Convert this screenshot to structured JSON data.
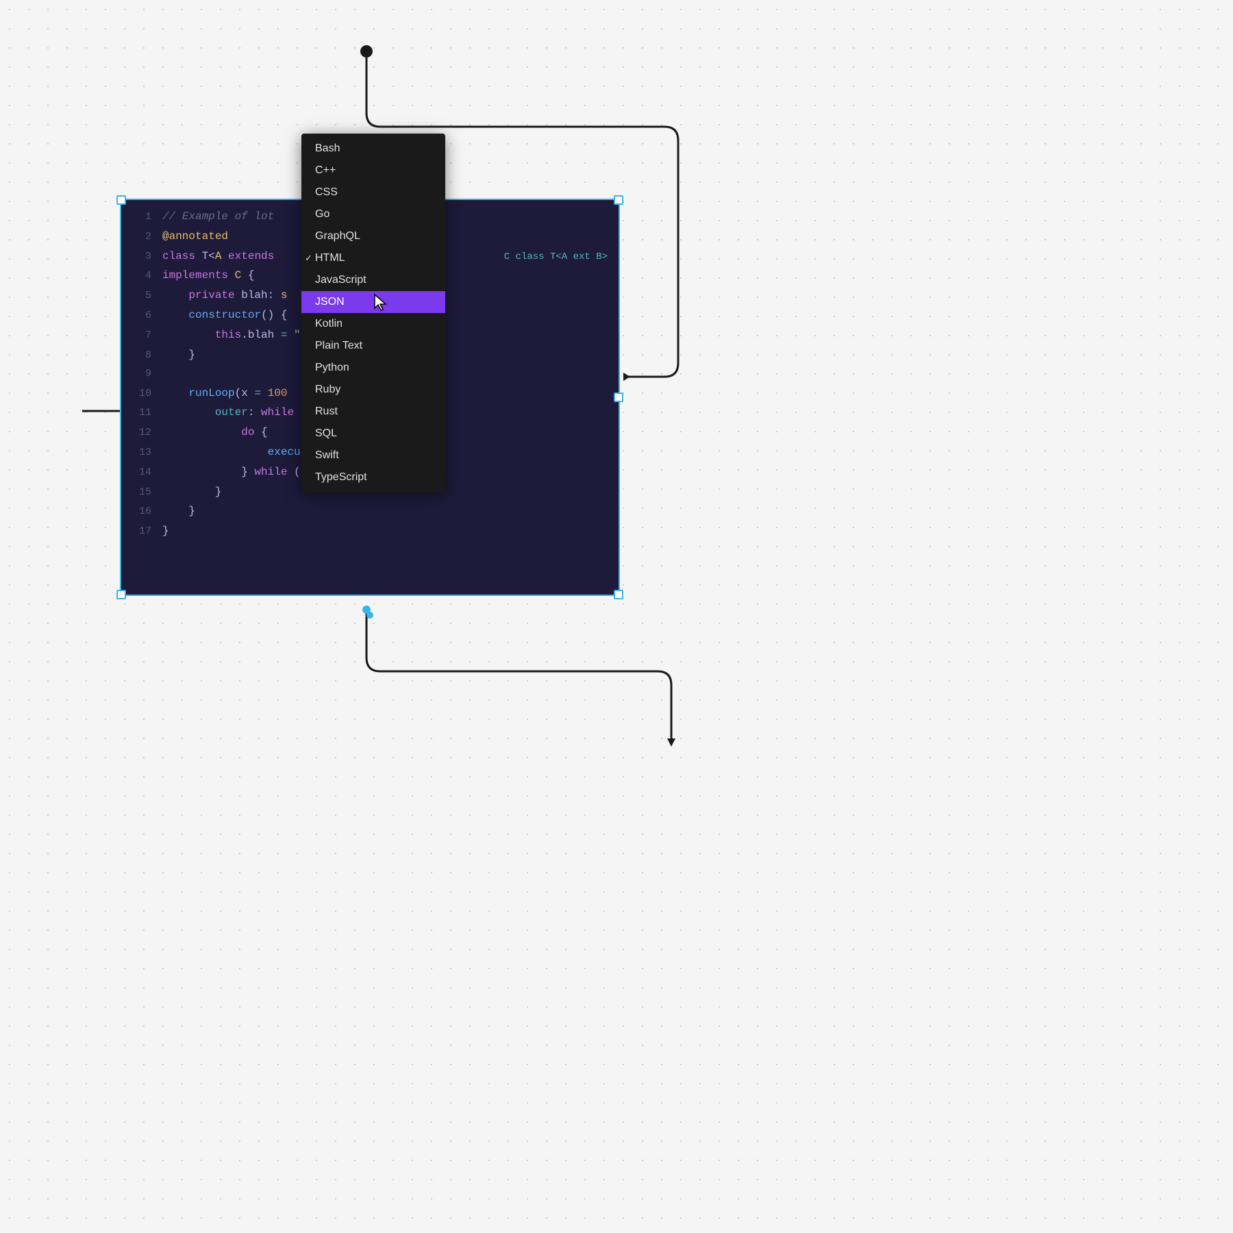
{
  "editor": {
    "lines": [
      {
        "num": "1",
        "content": "comment",
        "text": "// Example of lot"
      },
      {
        "num": "2",
        "content": "decorator",
        "text": "@annotated"
      },
      {
        "num": "3",
        "content": "class_decl",
        "text": "class T<A extends"
      },
      {
        "num": "4",
        "content": "implements",
        "text": "implements C {"
      },
      {
        "num": "5",
        "content": "private",
        "text": "    private blah: s"
      },
      {
        "num": "6",
        "content": "constructor",
        "text": "    constructor() {"
      },
      {
        "num": "7",
        "content": "assign",
        "text": "        this.blah = \""
      },
      {
        "num": "8",
        "content": "close",
        "text": "    }"
      },
      {
        "num": "9",
        "content": "empty",
        "text": ""
      },
      {
        "num": "10",
        "content": "runloop",
        "text": "    runLoop(x = 100"
      },
      {
        "num": "11",
        "content": "outer",
        "text": "        outer: while"
      },
      {
        "num": "12",
        "content": "do",
        "text": "            do {"
      },
      {
        "num": "13",
        "content": "execute",
        "text": "                execute(undefined);"
      },
      {
        "num": "14",
        "content": "while2",
        "text": "            } while (/.*x.?/.test(input));"
      },
      {
        "num": "15",
        "content": "close2",
        "text": "        }"
      },
      {
        "num": "16",
        "content": "close3",
        "text": "    }"
      },
      {
        "num": "17",
        "content": "close4",
        "text": "}"
      }
    ],
    "right_text": "C class T<A ext B>"
  },
  "dropdown": {
    "items": [
      {
        "label": "Bash",
        "selected": false,
        "checked": false
      },
      {
        "label": "C++",
        "selected": false,
        "checked": false
      },
      {
        "label": "CSS",
        "selected": false,
        "checked": false
      },
      {
        "label": "Go",
        "selected": false,
        "checked": false
      },
      {
        "label": "GraphQL",
        "selected": false,
        "checked": false
      },
      {
        "label": "HTML",
        "selected": false,
        "checked": true
      },
      {
        "label": "JavaScript",
        "selected": false,
        "checked": false
      },
      {
        "label": "JSON",
        "selected": true,
        "checked": false
      },
      {
        "label": "Kotlin",
        "selected": false,
        "checked": false
      },
      {
        "label": "Plain Text",
        "selected": false,
        "checked": false
      },
      {
        "label": "Python",
        "selected": false,
        "checked": false
      },
      {
        "label": "Ruby",
        "selected": false,
        "checked": false
      },
      {
        "label": "Rust",
        "selected": false,
        "checked": false
      },
      {
        "label": "SQL",
        "selected": false,
        "checked": false
      },
      {
        "label": "Swift",
        "selected": false,
        "checked": false
      },
      {
        "label": "TypeScript",
        "selected": false,
        "checked": false
      }
    ]
  }
}
